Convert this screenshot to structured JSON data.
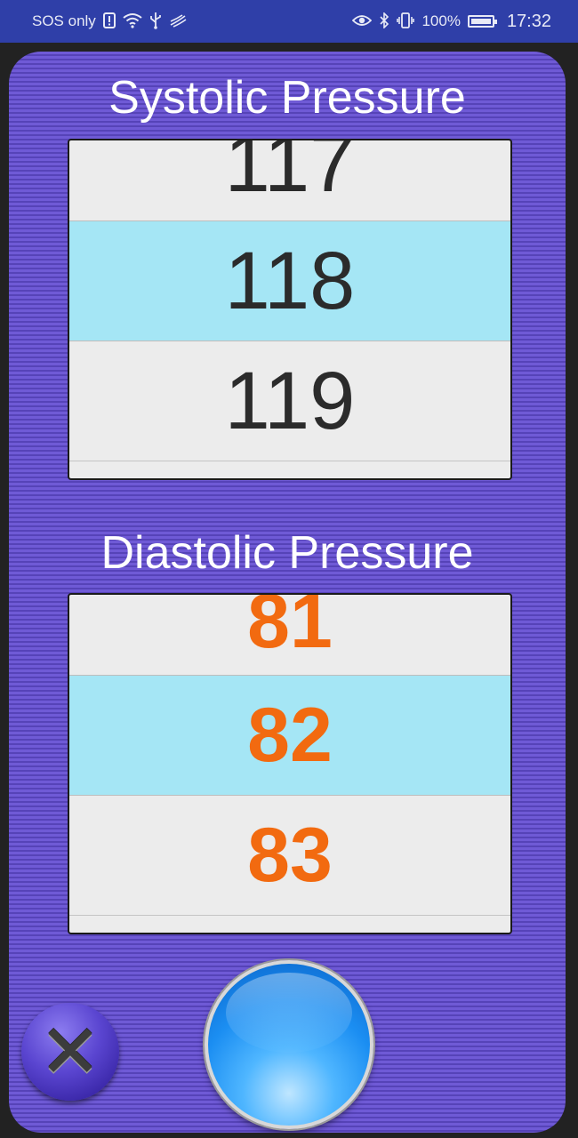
{
  "status_bar": {
    "carrier": "SOS only",
    "battery": "100%",
    "time": "17:32"
  },
  "systolic": {
    "title": "Systolic Pressure",
    "prev_value": "117",
    "selected_value": "118",
    "next_value": "119"
  },
  "diastolic": {
    "title": "Diastolic Pressure",
    "prev_value": "81",
    "selected_value": "82",
    "next_value": "83"
  },
  "buttons": {
    "cancel_glyph": "✕"
  },
  "colors": {
    "diastolic_text": "#f26a10",
    "selected_row": "#a5e6f5",
    "panel": "#6a55d0"
  }
}
